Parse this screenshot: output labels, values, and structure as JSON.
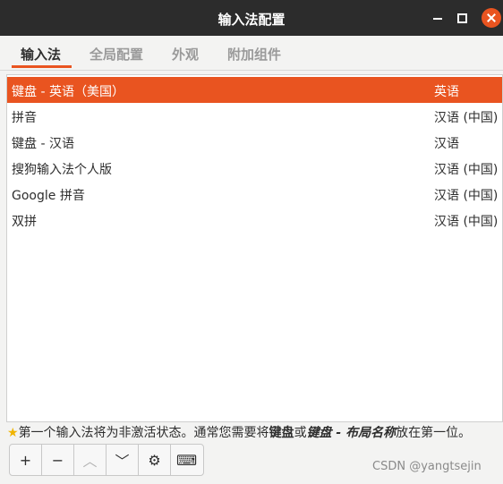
{
  "window": {
    "title": "输入法配置"
  },
  "tabs": [
    "输入法",
    "全局配置",
    "外观",
    "附加组件"
  ],
  "methods": [
    {
      "name": "键盘 - 英语（美国）",
      "lang": "英语",
      "selected": true
    },
    {
      "name": "拼音",
      "lang": "汉语 (中国)"
    },
    {
      "name": "键盘 - 汉语",
      "lang": "汉语"
    },
    {
      "name": "搜狗输入法个人版",
      "lang": "汉语 (中国)"
    },
    {
      "name": "Google 拼音",
      "lang": "汉语 (中国)"
    },
    {
      "name": "双拼",
      "lang": "汉语 (中国)"
    }
  ],
  "hint": {
    "icon": "star-icon",
    "prefix": "第一个输入法将为非激活状态。通常您需要将",
    "key1": "键盘",
    "mid": "或",
    "key2": "键盘 - 布局名称",
    "suffix": "放在第一位。"
  },
  "toolbar": {
    "add": "+",
    "remove": "−",
    "up": "︿",
    "down": "﹀",
    "configure": "⚙",
    "keyboard": "⌨"
  },
  "watermark": "CSDN @yangtsejin",
  "colors": {
    "accent": "#e95420",
    "titlebar": "#2c2c2c"
  }
}
